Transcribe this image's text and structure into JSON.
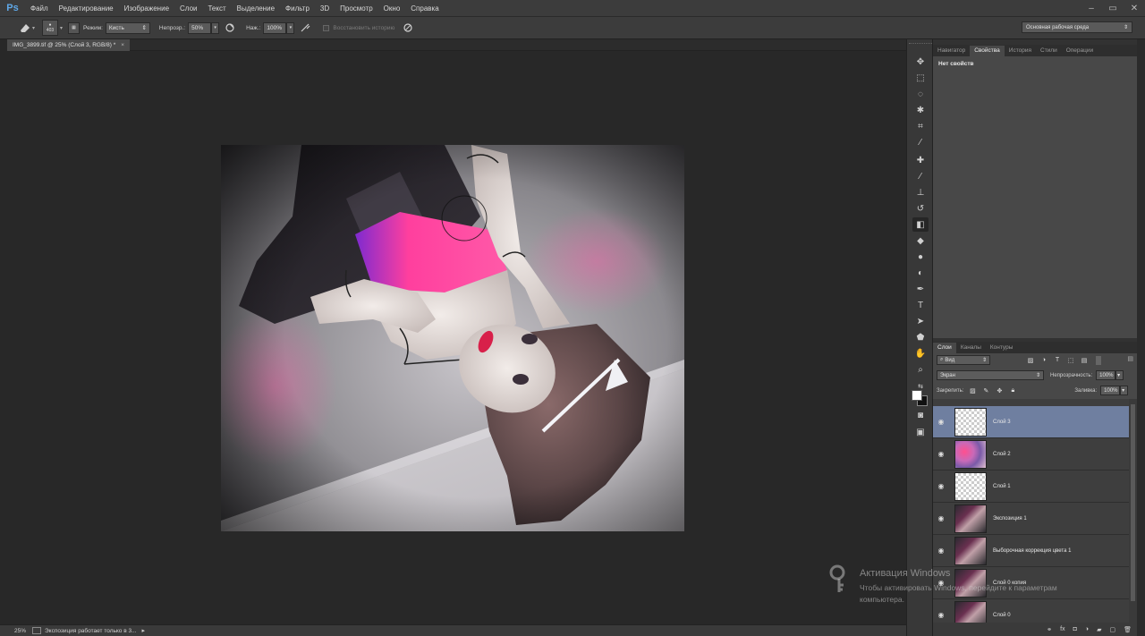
{
  "menu": {
    "logo": "Ps",
    "items": [
      "Файл",
      "Редактирование",
      "Изображение",
      "Слои",
      "Текст",
      "Выделение",
      "Фильтр",
      "3D",
      "Просмотр",
      "Окно",
      "Справка"
    ],
    "window_controls": [
      "minimize",
      "maximize",
      "close"
    ]
  },
  "options": {
    "brush_size": "403",
    "mode_label": "Режим:",
    "mode_value": "Кисть",
    "opacity_label": "Непрозр.:",
    "opacity_value": "50%",
    "pressure_label": "Наж.:",
    "pressure_value": "100%",
    "erase_history_label": "Восстановить историю",
    "workspace": "Основная рабочая среда"
  },
  "document": {
    "tab_title": "IMG_3899.tif @ 25% (Слой 3, RGB/8) *",
    "close": "×"
  },
  "status": {
    "zoom": "25%",
    "message": "Экспозиция работает только в 3..."
  },
  "properties_panel": {
    "tabs": [
      "Навигатор",
      "Свойства",
      "История",
      "Стили",
      "Операции"
    ],
    "active_tab": "Свойства",
    "body": "Нет свойств"
  },
  "layers_panel": {
    "tabs": [
      "Слои",
      "Каналы",
      "Контуры"
    ],
    "active_tab": "Слои",
    "filter_kind": "Вид",
    "blend_mode": "Экран",
    "opacity_label": "Непрозрачность:",
    "opacity_value": "100%",
    "lock_label": "Закрепить:",
    "fill_label": "Заливка:",
    "fill_value": "100%",
    "layers": [
      {
        "name": "Слой 3",
        "thumb": "checker",
        "selected": true
      },
      {
        "name": "Слой 2",
        "thumb": "colors",
        "selected": false
      },
      {
        "name": "Слой 1",
        "thumb": "checker",
        "selected": false
      },
      {
        "name": "Экспозиция 1",
        "thumb": "photo",
        "selected": false
      },
      {
        "name": "Выборочная коррекция цвета 1",
        "thumb": "photo",
        "selected": false
      },
      {
        "name": "Слой 0 копия",
        "thumb": "photo",
        "selected": false
      },
      {
        "name": "Слой 0",
        "thumb": "photo",
        "selected": false
      }
    ],
    "footer_icons": [
      "link-icon",
      "fx-icon",
      "mask-icon",
      "adjustment-icon",
      "group-icon",
      "new-layer-icon",
      "trash-icon"
    ]
  },
  "watermark": {
    "title": "Активация Windows",
    "line1": "Чтобы активировать Windows, перейдите к параметрам",
    "line2": "компьютера."
  },
  "colors": {
    "accent_selected_layer": "#6f7fa0",
    "background": "#282828",
    "panel": "#484848"
  }
}
